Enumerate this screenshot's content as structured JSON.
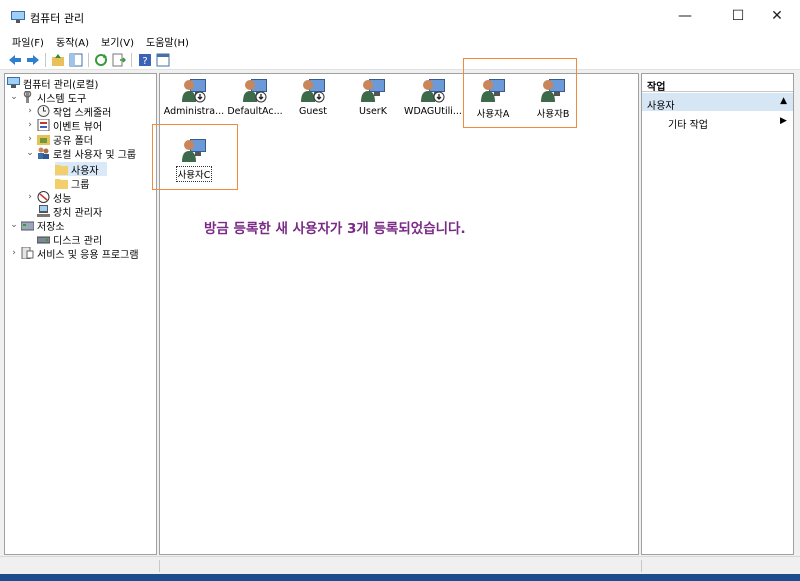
{
  "window": {
    "title": "컴퓨터 관리",
    "icon": "computer-management-icon",
    "minimize": "—",
    "maximize": "☐",
    "close": "✕"
  },
  "menu": [
    "파일(F)",
    "동작(A)",
    "보기(V)",
    "도움말(H)"
  ],
  "tree": {
    "root": "컴퓨터 관리(로컬)",
    "system_tools": "시스템 도구",
    "task_scheduler": "작업 스케줄러",
    "event_viewer": "이벤트 뷰어",
    "shared_folders": "공유 폴더",
    "local_users_groups": "로컬 사용자 및 그룹",
    "users": "사용자",
    "groups": "그룹",
    "performance": "성능",
    "device_manager": "장치 관리자",
    "storage": "저장소",
    "disk_management": "디스크 관리",
    "services_apps": "서비스 및 응용 프로그램"
  },
  "users": [
    "Administra...",
    "DefaultAc...",
    "Guest",
    "UserK",
    "WDAGUtili...",
    "사용자A",
    "사용자B",
    "사용자C"
  ],
  "notice": "방금 등록한 새 사용자가 3개 등록되었습니다.",
  "actions": {
    "header": "작업",
    "section": "사용자",
    "section_arrow": "▲",
    "item": "기타 작업",
    "item_arrow": "▶"
  },
  "colors": {
    "highlight_border": "#f08a3c",
    "notice_text": "#7a2a87",
    "selection": "#cce8ff"
  }
}
